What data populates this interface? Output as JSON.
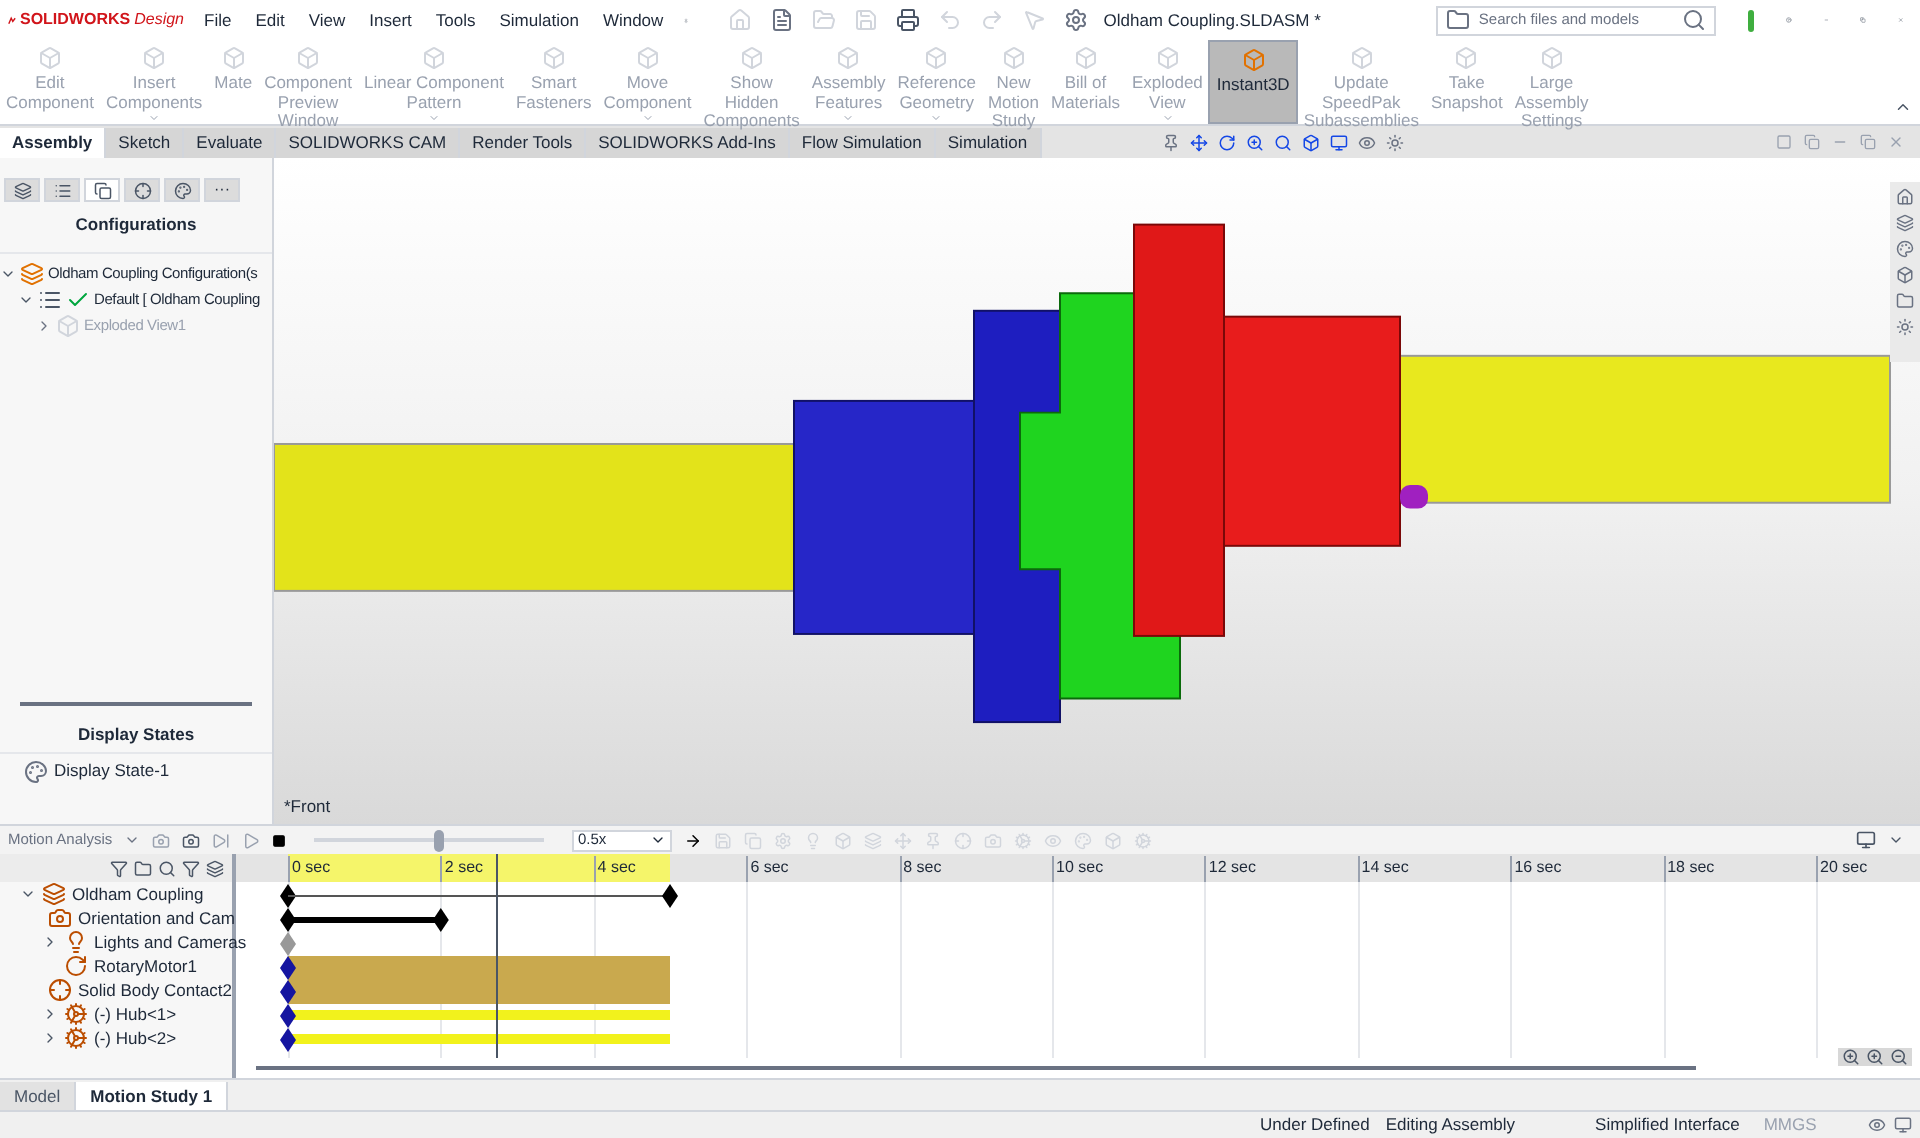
{
  "app": {
    "brand": "SOLIDWORKS",
    "edition": "Design"
  },
  "menu": [
    "File",
    "Edit",
    "View",
    "Insert",
    "Tools",
    "Simulation",
    "Window"
  ],
  "window": {
    "title": "Oldham Coupling.SLDASM *"
  },
  "search": {
    "placeholder": "Search files and models"
  },
  "ribbon": [
    {
      "lines": [
        "Edit",
        "Component"
      ],
      "disabled": true,
      "dropdown": false,
      "selected": false
    },
    {
      "lines": [
        "Insert",
        "Components"
      ],
      "disabled": true,
      "dropdown": true,
      "selected": false
    },
    {
      "lines": [
        "Mate"
      ],
      "disabled": true,
      "dropdown": false,
      "selected": false
    },
    {
      "lines": [
        "Component",
        "Preview",
        "Window"
      ],
      "disabled": true,
      "dropdown": false,
      "selected": false
    },
    {
      "lines": [
        "Linear Component",
        "Pattern"
      ],
      "disabled": true,
      "dropdown": true,
      "selected": false
    },
    {
      "lines": [
        "Smart",
        "Fasteners"
      ],
      "disabled": true,
      "dropdown": false,
      "selected": false
    },
    {
      "lines": [
        "Move",
        "Component"
      ],
      "disabled": true,
      "dropdown": true,
      "selected": false
    },
    {
      "lines": [
        "Show",
        "Hidden",
        "Components"
      ],
      "disabled": true,
      "dropdown": false,
      "selected": false
    },
    {
      "lines": [
        "Assembly",
        "Features"
      ],
      "disabled": true,
      "dropdown": true,
      "selected": false
    },
    {
      "lines": [
        "Reference",
        "Geometry"
      ],
      "disabled": true,
      "dropdown": true,
      "selected": false
    },
    {
      "lines": [
        "New",
        "Motion",
        "Study"
      ],
      "disabled": true,
      "dropdown": false,
      "selected": false
    },
    {
      "lines": [
        "Bill of",
        "Materials"
      ],
      "disabled": true,
      "dropdown": false,
      "selected": false
    },
    {
      "lines": [
        "Exploded",
        "View"
      ],
      "disabled": true,
      "dropdown": true,
      "selected": false
    },
    {
      "lines": [
        "Instant3D"
      ],
      "disabled": false,
      "dropdown": false,
      "selected": true
    },
    {
      "lines": [
        "Update",
        "SpeedPak",
        "Subassemblies"
      ],
      "disabled": true,
      "dropdown": false,
      "selected": false
    },
    {
      "lines": [
        "Take",
        "Snapshot"
      ],
      "disabled": true,
      "dropdown": false,
      "selected": false
    },
    {
      "lines": [
        "Large",
        "Assembly",
        "Settings"
      ],
      "disabled": true,
      "dropdown": false,
      "selected": false
    }
  ],
  "command_tabs": [
    {
      "label": "Assembly",
      "selected": true
    },
    {
      "label": "Sketch",
      "selected": false
    },
    {
      "label": "Evaluate",
      "selected": false
    },
    {
      "label": "SOLIDWORKS CAM",
      "selected": false
    },
    {
      "label": "Render Tools",
      "selected": false
    },
    {
      "label": "SOLIDWORKS Add-Ins",
      "selected": false
    },
    {
      "label": "Flow Simulation",
      "selected": false
    },
    {
      "label": "Simulation",
      "selected": false
    }
  ],
  "manager_tabs": [
    {
      "kind": "feature",
      "selected": false
    },
    {
      "kind": "property",
      "selected": false
    },
    {
      "kind": "configuration",
      "selected": true
    },
    {
      "kind": "dimxpert",
      "selected": false
    },
    {
      "kind": "display",
      "selected": false
    },
    {
      "kind": "more",
      "selected": false,
      "label": "···"
    }
  ],
  "configurations": {
    "heading": "Configurations",
    "tree": [
      {
        "label": "Oldham Coupling Configuration(s",
        "kind": "root",
        "expanded": true,
        "disabled": false,
        "children": [
          {
            "label": "Default [ Oldham Coupling",
            "kind": "config",
            "expanded": true,
            "disabled": false,
            "children": [
              {
                "label": "Exploded View1",
                "kind": "exploded",
                "expanded": false,
                "disabled": true
              }
            ]
          }
        ]
      }
    ]
  },
  "display_states": {
    "heading": "Display States",
    "items": [
      "Display State-1"
    ]
  },
  "view": {
    "orientation": "*Front"
  },
  "motion": {
    "study_type": "Motion Analysis",
    "speed": "0.5x",
    "slider": {
      "level": 0.55
    },
    "ticks": [
      "0 sec",
      "2 sec",
      "4 sec",
      "6 sec",
      "8 sec",
      "10 sec",
      "12 sec",
      "14 sec",
      "16 sec",
      "18 sec",
      "20 sec"
    ],
    "time_bar": {
      "level": 0.128
    },
    "tree": [
      {
        "label": "Oldham Coupling",
        "kind": "span",
        "expanded": true,
        "children": [
          {
            "label": "Orientation and Cam",
            "kind": "short"
          },
          {
            "label": "Lights and Cameras",
            "kind": "key",
            "expanded": false
          },
          {
            "label": "RotaryMotor1",
            "kind": "bar"
          },
          {
            "label": "Solid Body Contact2",
            "kind": "bar"
          },
          {
            "label": "(-) Hub<1>",
            "kind": "line",
            "expanded": false
          },
          {
            "label": "(-) Hub<2>",
            "kind": "line",
            "expanded": false
          }
        ]
      }
    ]
  },
  "bottom_tabs": [
    {
      "label": "Model",
      "selected": false
    },
    {
      "label": "Motion Study 1",
      "selected": true
    }
  ],
  "status_bar": {
    "items": [
      "Under Defined",
      "Editing Assembly",
      "Simplified Interface"
    ],
    "units": "MMGS"
  }
}
